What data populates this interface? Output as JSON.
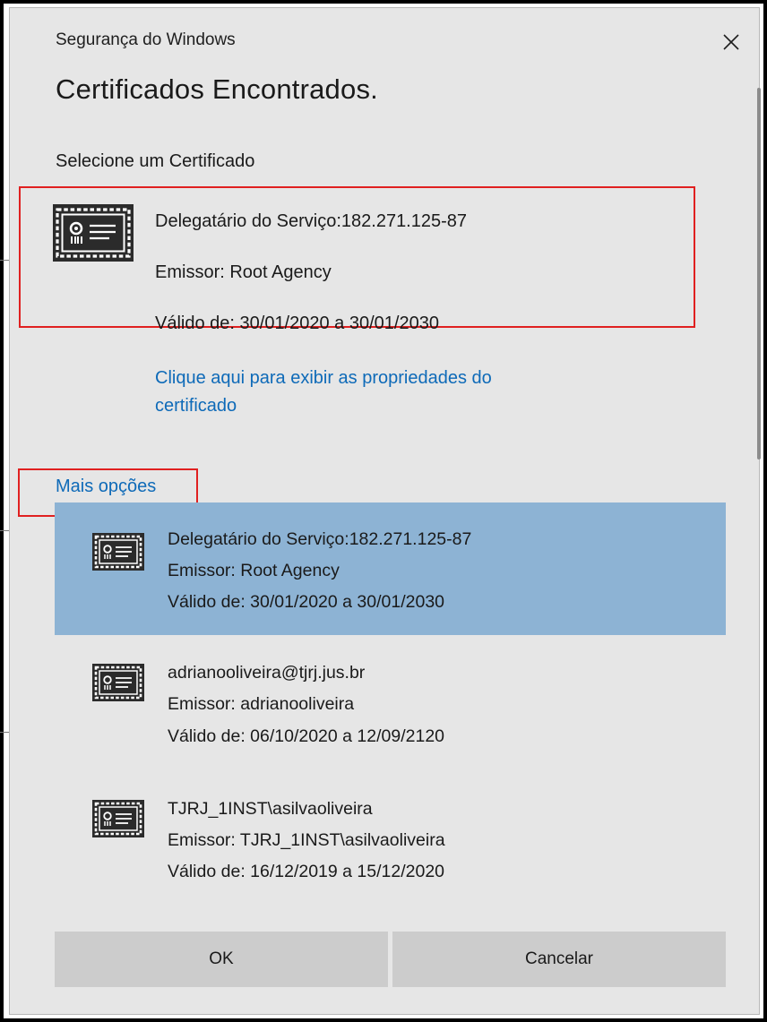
{
  "dialog": {
    "caption": "Segurança do Windows",
    "title": "Certificados Encontrados.",
    "subtitle": "Selecione um Certificado"
  },
  "selected_certificate": {
    "subject": "Delegatário do Serviço:182.271.125-87",
    "issuer": "Emissor: Root Agency",
    "validity": "Válido de: 30/01/2020 a 30/01/2030"
  },
  "properties_link": {
    "line1": "Clique aqui para exibir as propriedades do",
    "line2": "certificado"
  },
  "more_options_label": "Mais opções",
  "certificates": [
    {
      "subject": "Delegatário do Serviço:182.271.125-87",
      "issuer": "Emissor: Root Agency",
      "validity": "Válido de: 30/01/2020 a 30/01/2030",
      "selected": true
    },
    {
      "subject": "adrianooliveira@tjrj.jus.br",
      "issuer": "Emissor: adrianooliveira",
      "validity": "Válido de: 06/10/2020 a 12/09/2120",
      "selected": false
    },
    {
      "subject": "TJRJ_1INST\\asilvaoliveira",
      "issuer": "Emissor: TJRJ_1INST\\asilvaoliveira",
      "validity": "Válido de: 16/12/2019 a 15/12/2020",
      "selected": false
    }
  ],
  "buttons": {
    "ok": "OK",
    "cancel": "Cancelar"
  },
  "colors": {
    "dialog_bg": "#e6e6e6",
    "selection_bg": "#8db3d4",
    "link": "#0e6ab8",
    "highlight_border": "#e02020",
    "button_bg": "#cccccc"
  },
  "icons": {
    "close": "close-icon",
    "certificate": "certificate-icon"
  }
}
